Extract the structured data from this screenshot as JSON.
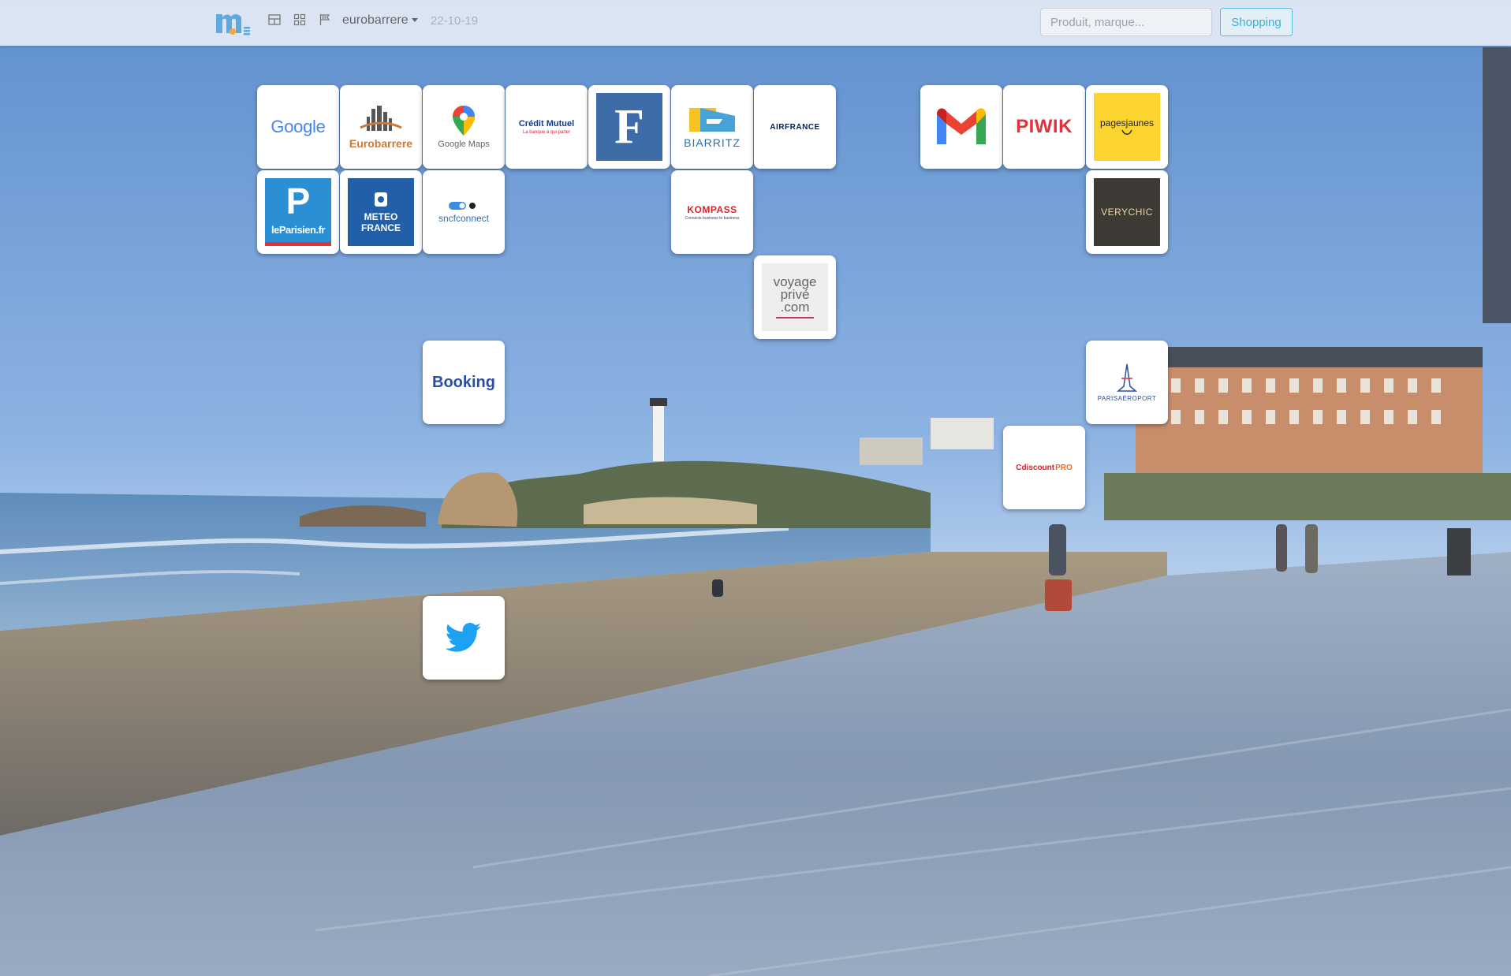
{
  "topbar": {
    "logo_icon": "m-logo-icon",
    "layout_icons": [
      "layout-grid-icon",
      "layout-tiles-icon",
      "flag-icon"
    ],
    "user_label": "eurobarrere",
    "date": "22-10-19",
    "search_placeholder": "Produit, marque...",
    "shopping_label": "Shopping"
  },
  "tiles": {
    "google": {
      "text": "Google"
    },
    "eurobarrere": {
      "text": "Eurobarrere"
    },
    "googlemaps": {
      "text": "Google Maps"
    },
    "creditmutuel": {
      "text": "Crédit Mutuel",
      "sub": "La banque à qui parler"
    },
    "lefigaro": {
      "text": "F"
    },
    "biarritz": {
      "text": "BIARRITZ"
    },
    "airfrance": {
      "text": "AIRFRANCE"
    },
    "gmail": {
      "text": "M"
    },
    "piwik": {
      "text": "PIWIK"
    },
    "pagesjaunes": {
      "text": "pagesjaunes"
    },
    "leparisien": {
      "text": "leParisien.fr",
      "letter": "P"
    },
    "meteofrance": {
      "line1": "METEO",
      "line2": "FRANCE"
    },
    "sncfconnect": {
      "text": "sncfconnect"
    },
    "kompass": {
      "text": "KOMPASS",
      "sub": "Connects business to business"
    },
    "verychic": {
      "text": "VERYCHIC"
    },
    "voyageprive": {
      "line1": "voyage",
      "line2": "privé",
      "line3": ".com"
    },
    "booking": {
      "text": "Booking"
    },
    "parisaeroport": {
      "text": "PARISAÉROPORT"
    },
    "cdiscountpro": {
      "text": "Cdiscount",
      "pro": "PRO"
    },
    "twitter": {
      "icon": "twitter-bird-icon"
    }
  },
  "colors": {
    "topbar_bg": "#e2e9f4",
    "accent": "#3ab1d8",
    "tile_bg": "#ffffff"
  }
}
